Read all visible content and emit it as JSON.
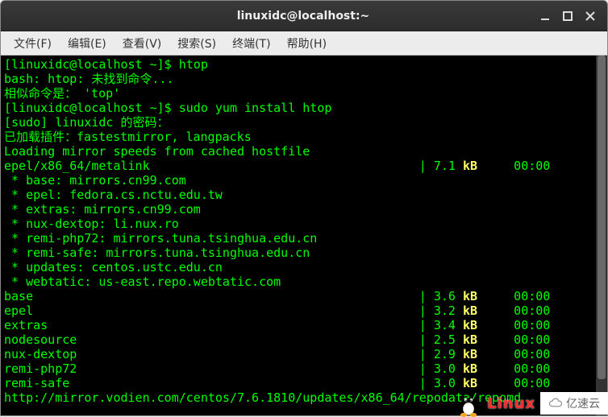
{
  "titlebar": {
    "title": "linuxidc@localhost:~"
  },
  "menubar": {
    "items": [
      {
        "label": "文件(F)"
      },
      {
        "label": "编辑(E)"
      },
      {
        "label": "查看(V)"
      },
      {
        "label": "搜索(S)"
      },
      {
        "label": "终端(T)"
      },
      {
        "label": "帮助(H)"
      }
    ]
  },
  "terminal": {
    "lines": [
      "[linuxidc@localhost ~]$ htop",
      "bash: htop: 未找到命令...",
      "相似命令是： 'top'",
      "[linuxidc@localhost ~]$ sudo yum install htop",
      "[sudo] linuxidc 的密码：",
      "已加载插件：fastestmirror, langpacks",
      "Loading mirror speeds from cached hostfile"
    ],
    "metalink": {
      "name": "epel/x86_64/metalink",
      "size_val": "7.1",
      "size_unit": "kB",
      "time": "00:00"
    },
    "mirrors": [
      " * base: mirrors.cn99.com",
      " * epel: fedora.cs.nctu.edu.tw",
      " * extras: mirrors.cn99.com",
      " * nux-dextop: li.nux.ro",
      " * remi-php72: mirrors.tuna.tsinghua.edu.cn",
      " * remi-safe: mirrors.tuna.tsinghua.edu.cn",
      " * updates: centos.ustc.edu.cn",
      " * webtatic: us-east.repo.webtatic.com"
    ],
    "repos": [
      {
        "name": "base",
        "size_val": "3.6",
        "size_unit": "kB",
        "time": "00:00"
      },
      {
        "name": "epel",
        "size_val": "3.2",
        "size_unit": "kB",
        "time": "00:00"
      },
      {
        "name": "extras",
        "size_val": "3.4",
        "size_unit": "kB",
        "time": "00:00"
      },
      {
        "name": "nodesource",
        "size_val": "2.5",
        "size_unit": "kB",
        "time": "00:00"
      },
      {
        "name": "nux-dextop",
        "size_val": "2.9",
        "size_unit": "kB",
        "time": "00:00"
      },
      {
        "name": "remi-php72",
        "size_val": "3.0",
        "size_unit": "kB",
        "time": "00:00"
      },
      {
        "name": "remi-safe",
        "size_val": "3.0",
        "size_unit": "kB",
        "time": "00:00"
      }
    ],
    "bottom_url": "http://mirror.vodien.com/centos/7.6.1810/updates/x86_64/repodata/repomd"
  },
  "watermark": {
    "linux_text": "Linux",
    "yisu_text": "亿速云"
  }
}
